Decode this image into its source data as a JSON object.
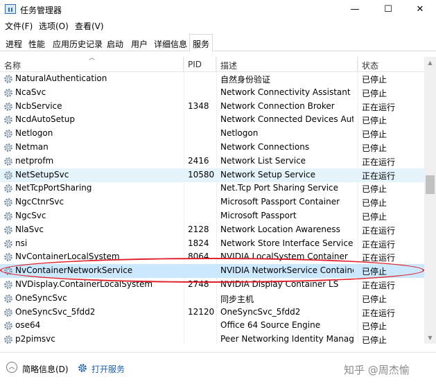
{
  "window": {
    "title": "任务管理器",
    "minimize": "—",
    "maximize": "☐",
    "close": "✕"
  },
  "menu": [
    "文件(F)",
    "选项(O)",
    "查看(V)"
  ],
  "tabs": [
    "进程",
    "性能",
    "应用历史记录",
    "启动",
    "用户",
    "详细信息",
    "服务"
  ],
  "active_tab": "服务",
  "columns": {
    "name": "名称",
    "pid": "PID",
    "desc": "描述",
    "state": "状态"
  },
  "rows": [
    {
      "name": "NaturalAuthentication",
      "pid": "",
      "desc": "自然身份验证",
      "state": "已停止"
    },
    {
      "name": "NcaSvc",
      "pid": "",
      "desc": "Network Connectivity Assistant",
      "state": "已停止"
    },
    {
      "name": "NcbService",
      "pid": "1348",
      "desc": "Network Connection Broker",
      "state": "正在运行"
    },
    {
      "name": "NcdAutoSetup",
      "pid": "",
      "desc": "Network Connected Devices Auto-Setup",
      "state": "已停止"
    },
    {
      "name": "Netlogon",
      "pid": "",
      "desc": "Netlogon",
      "state": "已停止"
    },
    {
      "name": "Netman",
      "pid": "",
      "desc": "Network Connections",
      "state": "已停止"
    },
    {
      "name": "netprofm",
      "pid": "2416",
      "desc": "Network List Service",
      "state": "正在运行"
    },
    {
      "name": "NetSetupSvc",
      "pid": "10580",
      "desc": "Network Setup Service",
      "state": "正在运行"
    },
    {
      "name": "NetTcpPortSharing",
      "pid": "",
      "desc": "Net.Tcp Port Sharing Service",
      "state": "已停止"
    },
    {
      "name": "NgcCtnrSvc",
      "pid": "",
      "desc": "Microsoft Passport Container",
      "state": "已停止"
    },
    {
      "name": "NgcSvc",
      "pid": "",
      "desc": "Microsoft Passport",
      "state": "已停止"
    },
    {
      "name": "NlaSvc",
      "pid": "2128",
      "desc": "Network Location Awareness",
      "state": "正在运行"
    },
    {
      "name": "nsi",
      "pid": "1824",
      "desc": "Network Store Interface Service",
      "state": "正在运行"
    },
    {
      "name": "NvContainerLocalSystem",
      "pid": "8064",
      "desc": "NVIDIA LocalSystem Container",
      "state": "正在运行"
    },
    {
      "name": "NvContainerNetworkService",
      "pid": "",
      "desc": "NVIDIA NetworkService Container",
      "state": "已停止"
    },
    {
      "name": "NVDisplay.ContainerLocalSystem",
      "pid": "2748",
      "desc": "NVIDIA Display Container LS",
      "state": "正在运行"
    },
    {
      "name": "OneSyncSvc",
      "pid": "",
      "desc": "同步主机",
      "state": "已停止"
    },
    {
      "name": "OneSyncSvc_5fdd2",
      "pid": "12120",
      "desc": "OneSyncSvc_5fdd2",
      "state": "正在运行"
    },
    {
      "name": "ose64",
      "pid": "",
      "desc": "Office 64 Source Engine",
      "state": "已停止"
    },
    {
      "name": "p2pimsvc",
      "pid": "",
      "desc": "Peer Networking Identity Manager",
      "state": "已停止"
    }
  ],
  "hover_row": "NetSetupSvc",
  "selected_row": "NvContainerNetworkService",
  "footer": {
    "brief": "简略信息(D)",
    "open_services": "打开服务",
    "watermark": "知乎 @周杰愉"
  },
  "colors": {
    "highlight_ring": "#e0202a",
    "link": "#1a5fb4",
    "selected": "#cce8ff",
    "hover": "#e5f3fb"
  }
}
